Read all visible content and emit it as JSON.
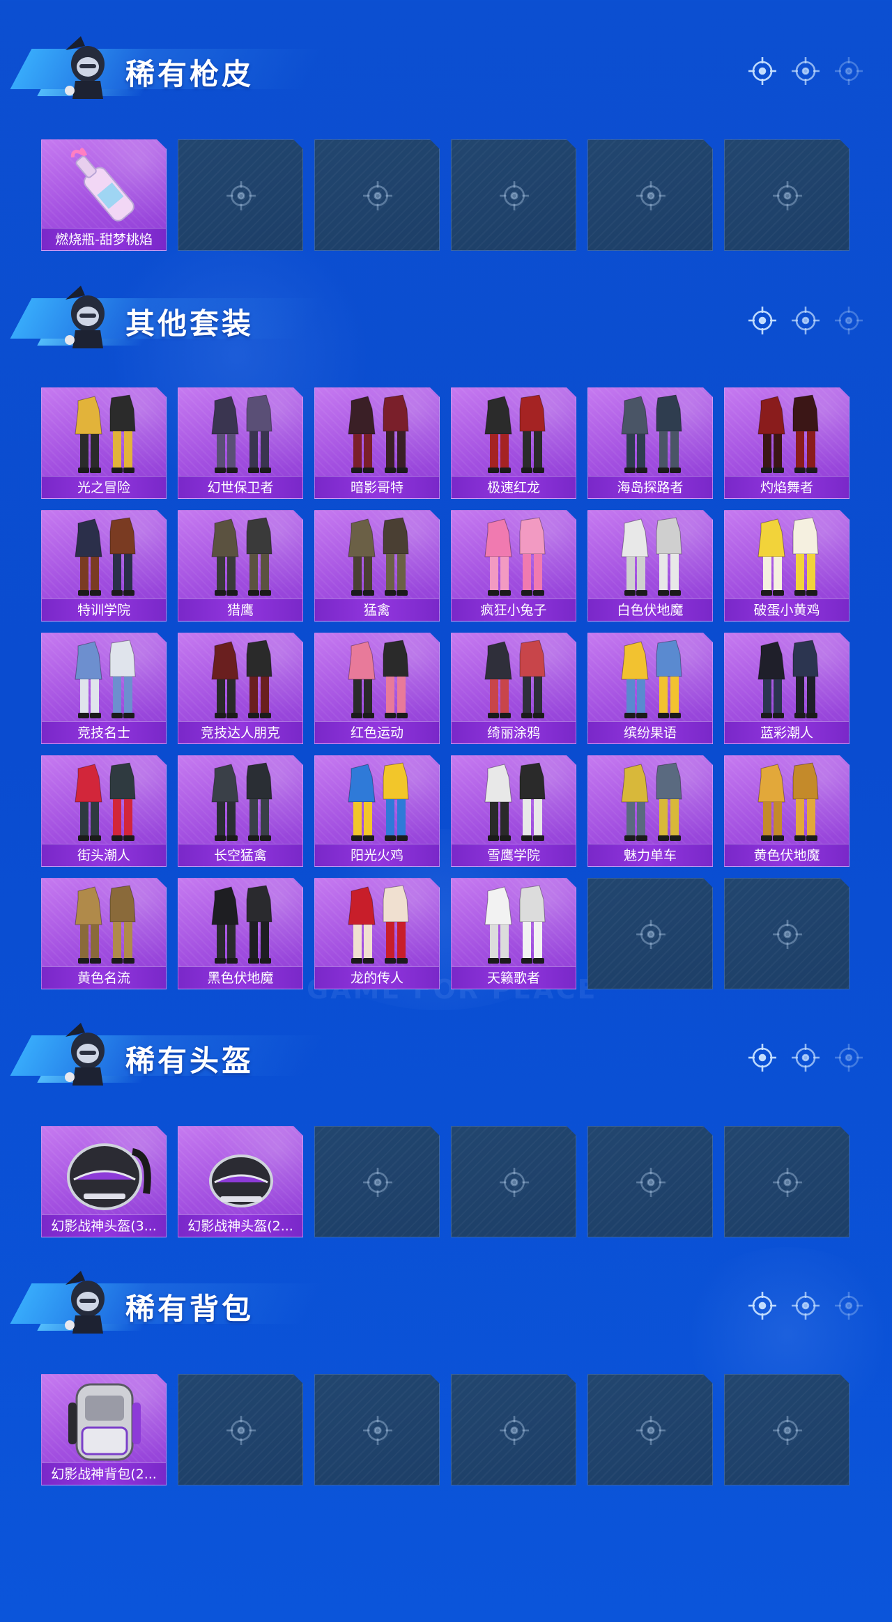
{
  "sections": [
    {
      "title": "稀有枪皮",
      "items": [
        {
          "label": "燃烧瓶-甜梦桃焰",
          "art": "bottle"
        },
        null,
        null,
        null,
        null,
        null
      ]
    },
    {
      "title": "其他套装",
      "items": [
        {
          "label": "光之冒险",
          "art": "outfit",
          "colors": [
            "#e2b33a",
            "#2b2b2b"
          ]
        },
        {
          "label": "幻世保卫者",
          "art": "outfit",
          "colors": [
            "#3a3550",
            "#5a4f76"
          ]
        },
        {
          "label": "暗影哥特",
          "art": "outfit",
          "colors": [
            "#3a1f26",
            "#7a1f2a"
          ]
        },
        {
          "label": "极速红龙",
          "art": "outfit",
          "colors": [
            "#2b2b2b",
            "#a52323"
          ]
        },
        {
          "label": "海岛探路者",
          "art": "outfit",
          "colors": [
            "#4a5566",
            "#2f3d4f"
          ]
        },
        {
          "label": "灼焰舞者",
          "art": "outfit",
          "colors": [
            "#8a1c1c",
            "#3b1616"
          ]
        },
        {
          "label": "特训学院",
          "art": "outfit",
          "colors": [
            "#2b2f4a",
            "#7a3b22"
          ]
        },
        {
          "label": "猎鹰",
          "art": "outfit",
          "colors": [
            "#5b5240",
            "#3a3a3a"
          ]
        },
        {
          "label": "猛禽",
          "art": "outfit",
          "colors": [
            "#6b6046",
            "#4a3f33"
          ]
        },
        {
          "label": "疯狂小兔子",
          "art": "outfit",
          "colors": [
            "#f07ab0",
            "#f29ac2"
          ]
        },
        {
          "label": "白色伏地魔",
          "art": "outfit",
          "colors": [
            "#e8e8e8",
            "#cfcfcf"
          ]
        },
        {
          "label": "破蛋小黄鸡",
          "art": "outfit",
          "colors": [
            "#f2d33a",
            "#f5f0e0"
          ]
        },
        {
          "label": "竞技名士",
          "art": "outfit",
          "colors": [
            "#6d8fcf",
            "#e0e4ec"
          ]
        },
        {
          "label": "竞技达人朋克",
          "art": "outfit",
          "colors": [
            "#6a1f1f",
            "#2a2a2a"
          ]
        },
        {
          "label": "红色运动",
          "art": "outfit",
          "colors": [
            "#e87a9a",
            "#2a2a2a"
          ]
        },
        {
          "label": "绮丽涂鸦",
          "art": "outfit",
          "colors": [
            "#2f2f3a",
            "#c8454a"
          ]
        },
        {
          "label": "缤纷果语",
          "art": "outfit",
          "colors": [
            "#f2c230",
            "#5a8ad0"
          ]
        },
        {
          "label": "蓝彩潮人",
          "art": "outfit",
          "colors": [
            "#1f1f2a",
            "#2c3550"
          ]
        },
        {
          "label": "街头潮人",
          "art": "outfit",
          "colors": [
            "#d2263a",
            "#2f3a40"
          ]
        },
        {
          "label": "长空猛禽",
          "art": "outfit",
          "colors": [
            "#3a4048",
            "#2a2e34"
          ]
        },
        {
          "label": "阳光火鸡",
          "art": "outfit",
          "colors": [
            "#2f7ad8",
            "#f2c62a"
          ]
        },
        {
          "label": "雪鹰学院",
          "art": "outfit",
          "colors": [
            "#e8e8e8",
            "#2a2a2a"
          ]
        },
        {
          "label": "魅力单车",
          "art": "outfit",
          "colors": [
            "#d8b83a",
            "#5a6a80"
          ]
        },
        {
          "label": "黄色伏地魔",
          "art": "outfit",
          "colors": [
            "#e2a83a",
            "#c48a2a"
          ]
        },
        {
          "label": "黄色名流",
          "art": "outfit",
          "colors": [
            "#b08a4a",
            "#8a6a3a"
          ]
        },
        {
          "label": "黑色伏地魔",
          "art": "outfit",
          "colors": [
            "#1e1e22",
            "#2a2a2e"
          ]
        },
        {
          "label": "龙的传人",
          "art": "outfit",
          "colors": [
            "#c81e2a",
            "#f0e0d0"
          ]
        },
        {
          "label": "天籁歌者",
          "art": "outfit",
          "colors": [
            "#f2f2f2",
            "#dcdcdc"
          ]
        },
        null,
        null
      ]
    },
    {
      "title": "稀有头盔",
      "items": [
        {
          "label": "幻影战神头盔(3...",
          "art": "helmet"
        },
        {
          "label": "幻影战神头盔(2...",
          "art": "helmet2"
        },
        null,
        null,
        null,
        null
      ]
    },
    {
      "title": "稀有背包",
      "items": [
        {
          "label": "幻影战神背包(2...",
          "art": "backpack"
        },
        null,
        null,
        null,
        null,
        null
      ]
    }
  ],
  "background_text": "GAME FOR PEACE",
  "colors": {
    "background": "#0b4fd2",
    "card_filled": "#a24fe0",
    "card_label": "#8a32d8",
    "card_empty": "#1f426b"
  }
}
